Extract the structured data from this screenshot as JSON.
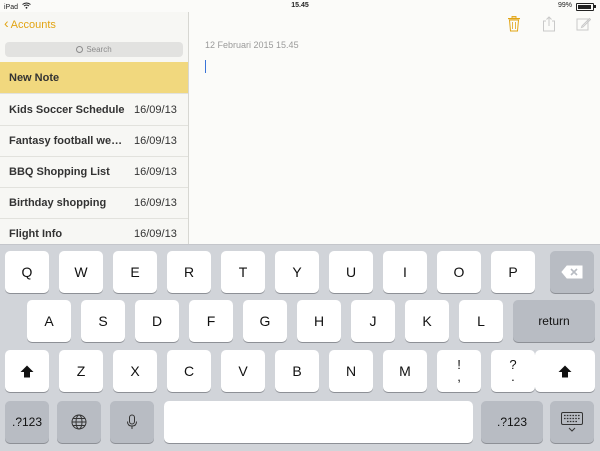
{
  "status": {
    "device": "iPad",
    "time": "15.45",
    "battery": "99%"
  },
  "sidebar": {
    "back_label": "Accounts",
    "search_placeholder": "Search",
    "notes": [
      {
        "title": "New Note",
        "date": ""
      },
      {
        "title": "Kids Soccer Schedule",
        "date": "16/09/13"
      },
      {
        "title": "Fantasy football weekly",
        "date": "16/09/13"
      },
      {
        "title": "BBQ Shopping List",
        "date": "16/09/13"
      },
      {
        "title": "Birthday shopping",
        "date": "16/09/13"
      },
      {
        "title": "Flight Info",
        "date": "16/09/13"
      }
    ]
  },
  "detail": {
    "date": "12 Februari 2015 15.45"
  },
  "colors": {
    "accent": "#e2a413",
    "selected_row": "#f1d87e",
    "keyboard_bg": "#d1d4d9"
  },
  "keyboard": {
    "row1": [
      "Q",
      "W",
      "E",
      "R",
      "T",
      "Y",
      "U",
      "I",
      "O",
      "P"
    ],
    "row2": [
      "A",
      "S",
      "D",
      "F",
      "G",
      "H",
      "J",
      "K",
      "L"
    ],
    "row3": [
      "Z",
      "X",
      "C",
      "V",
      "B",
      "N",
      "M"
    ],
    "row3_punct": [
      {
        "top": "!",
        "bottom": ","
      },
      {
        "top": "?",
        "bottom": "."
      }
    ],
    "return": "return",
    "numbers": ".?123"
  }
}
